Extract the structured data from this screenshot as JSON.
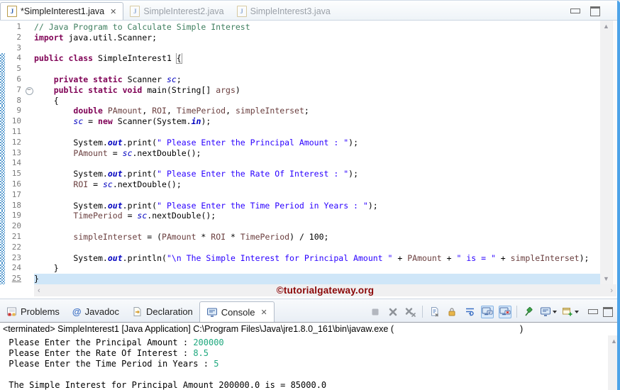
{
  "window": {
    "controls": {
      "minimize": "minimize",
      "maximize": "maximize"
    }
  },
  "editor_tabs": [
    {
      "label": "*SimpleInterest1.java",
      "active": true,
      "dirty": true
    },
    {
      "label": "SimpleInterest2.java",
      "active": false
    },
    {
      "label": "SimpleInterest3.java",
      "active": false
    }
  ],
  "editor": {
    "current_line": 25,
    "code_lines": [
      {
        "num": 1,
        "diff": false,
        "segments": [
          {
            "t": "// Java Program to Calculate Simple Interest",
            "s": "c"
          }
        ]
      },
      {
        "num": 2,
        "diff": false,
        "segments": [
          {
            "t": "import",
            "s": "k"
          },
          {
            "t": " java.util.Scanner;",
            "s": "p"
          }
        ]
      },
      {
        "num": 3,
        "diff": false,
        "segments": []
      },
      {
        "num": 4,
        "diff": true,
        "segments": [
          {
            "t": "public class",
            "s": "k"
          },
          {
            "t": " SimpleInterest1 ",
            "s": "p"
          },
          {
            "t": "{",
            "s": "b"
          }
        ]
      },
      {
        "num": 5,
        "diff": true,
        "segments": []
      },
      {
        "num": 6,
        "diff": true,
        "segments": [
          {
            "t": "    ",
            "s": "p"
          },
          {
            "t": "private static",
            "s": "k"
          },
          {
            "t": " Scanner ",
            "s": "p"
          },
          {
            "t": "sc",
            "s": "sf"
          },
          {
            "t": ";",
            "s": "p"
          }
        ]
      },
      {
        "num": 7,
        "diff": true,
        "fold": true,
        "segments": [
          {
            "t": "    ",
            "s": "p"
          },
          {
            "t": "public static void",
            "s": "k"
          },
          {
            "t": " main(String[] ",
            "s": "p"
          },
          {
            "t": "args",
            "s": "v"
          },
          {
            "t": ")",
            "s": "p"
          }
        ]
      },
      {
        "num": 8,
        "diff": true,
        "segments": [
          {
            "t": "    {",
            "s": "p"
          }
        ]
      },
      {
        "num": 9,
        "diff": true,
        "segments": [
          {
            "t": "        ",
            "s": "p"
          },
          {
            "t": "double",
            "s": "k"
          },
          {
            "t": " ",
            "s": "p"
          },
          {
            "t": "PAmount",
            "s": "v"
          },
          {
            "t": ", ",
            "s": "p"
          },
          {
            "t": "ROI",
            "s": "v"
          },
          {
            "t": ", ",
            "s": "p"
          },
          {
            "t": "TimePeriod",
            "s": "v"
          },
          {
            "t": ", ",
            "s": "p"
          },
          {
            "t": "simpleInterset",
            "s": "v"
          },
          {
            "t": ";",
            "s": "p"
          }
        ]
      },
      {
        "num": 10,
        "diff": true,
        "segments": [
          {
            "t": "        ",
            "s": "p"
          },
          {
            "t": "sc",
            "s": "sf"
          },
          {
            "t": " = ",
            "s": "p"
          },
          {
            "t": "new",
            "s": "k"
          },
          {
            "t": " Scanner(System.",
            "s": "p"
          },
          {
            "t": "in",
            "s": "cf"
          },
          {
            "t": ");",
            "s": "p"
          }
        ]
      },
      {
        "num": 11,
        "diff": true,
        "segments": []
      },
      {
        "num": 12,
        "diff": true,
        "segments": [
          {
            "t": "        System.",
            "s": "p"
          },
          {
            "t": "out",
            "s": "cf"
          },
          {
            "t": ".print(",
            "s": "p"
          },
          {
            "t": "\" Please Enter the Principal Amount : \"",
            "s": "s"
          },
          {
            "t": ");",
            "s": "p"
          }
        ]
      },
      {
        "num": 13,
        "diff": true,
        "segments": [
          {
            "t": "        ",
            "s": "p"
          },
          {
            "t": "PAmount",
            "s": "v"
          },
          {
            "t": " = ",
            "s": "p"
          },
          {
            "t": "sc",
            "s": "sf"
          },
          {
            "t": ".nextDouble();",
            "s": "p"
          }
        ]
      },
      {
        "num": 14,
        "diff": true,
        "segments": []
      },
      {
        "num": 15,
        "diff": true,
        "segments": [
          {
            "t": "        System.",
            "s": "p"
          },
          {
            "t": "out",
            "s": "cf"
          },
          {
            "t": ".print(",
            "s": "p"
          },
          {
            "t": "\" Please Enter the Rate Of Interest : \"",
            "s": "s"
          },
          {
            "t": ");",
            "s": "p"
          }
        ]
      },
      {
        "num": 16,
        "diff": true,
        "segments": [
          {
            "t": "        ",
            "s": "p"
          },
          {
            "t": "ROI",
            "s": "v"
          },
          {
            "t": " = ",
            "s": "p"
          },
          {
            "t": "sc",
            "s": "sf"
          },
          {
            "t": ".nextDouble();",
            "s": "p"
          }
        ]
      },
      {
        "num": 17,
        "diff": true,
        "segments": []
      },
      {
        "num": 18,
        "diff": true,
        "segments": [
          {
            "t": "        System.",
            "s": "p"
          },
          {
            "t": "out",
            "s": "cf"
          },
          {
            "t": ".print(",
            "s": "p"
          },
          {
            "t": "\" Please Enter the Time Period in Years : \"",
            "s": "s"
          },
          {
            "t": ");",
            "s": "p"
          }
        ]
      },
      {
        "num": 19,
        "diff": true,
        "segments": [
          {
            "t": "        ",
            "s": "p"
          },
          {
            "t": "TimePeriod",
            "s": "v"
          },
          {
            "t": " = ",
            "s": "p"
          },
          {
            "t": "sc",
            "s": "sf"
          },
          {
            "t": ".nextDouble();",
            "s": "p"
          }
        ]
      },
      {
        "num": 20,
        "diff": true,
        "segments": []
      },
      {
        "num": 21,
        "diff": true,
        "segments": [
          {
            "t": "        ",
            "s": "p"
          },
          {
            "t": "simpleInterset",
            "s": "v"
          },
          {
            "t": " = (",
            "s": "p"
          },
          {
            "t": "PAmount",
            "s": "v"
          },
          {
            "t": " * ",
            "s": "p"
          },
          {
            "t": "ROI",
            "s": "v"
          },
          {
            "t": " * ",
            "s": "p"
          },
          {
            "t": "TimePeriod",
            "s": "v"
          },
          {
            "t": ") / 100;",
            "s": "p"
          }
        ]
      },
      {
        "num": 22,
        "diff": true,
        "segments": []
      },
      {
        "num": 23,
        "diff": true,
        "segments": [
          {
            "t": "        System.",
            "s": "p"
          },
          {
            "t": "out",
            "s": "cf"
          },
          {
            "t": ".println(",
            "s": "p"
          },
          {
            "t": "\"\\n The Simple Interest for Principal Amount \"",
            "s": "s"
          },
          {
            "t": " + ",
            "s": "p"
          },
          {
            "t": "PAmount",
            "s": "v"
          },
          {
            "t": " + ",
            "s": "p"
          },
          {
            "t": "\" is = \"",
            "s": "s"
          },
          {
            "t": " + ",
            "s": "p"
          },
          {
            "t": "simpleInterset",
            "s": "v"
          },
          {
            "t": ");",
            "s": "p"
          }
        ]
      },
      {
        "num": 24,
        "diff": true,
        "segments": [
          {
            "t": "    }",
            "s": "p"
          }
        ]
      },
      {
        "num": 25,
        "diff": true,
        "current": true,
        "segments": [
          {
            "t": "}",
            "s": "p"
          }
        ]
      }
    ]
  },
  "watermark": "©tutorialgateway.org",
  "console": {
    "tabs": [
      {
        "label": "Problems",
        "icon": "problems-icon",
        "active": false
      },
      {
        "label": "Javadoc",
        "icon": "javadoc-icon",
        "active": false
      },
      {
        "label": "Declaration",
        "icon": "declaration-icon",
        "active": false
      },
      {
        "label": "Console",
        "icon": "console-icon",
        "active": true
      }
    ],
    "status": {
      "prefix": "<terminated> SimpleInterest1 [Java Application] C:\\Program Files\\Java\\jre1.8.0_161\\bin\\javaw.exe (",
      "suffix": ")"
    },
    "output": [
      {
        "segments": [
          {
            "t": " Please Enter the Principal Amount : ",
            "s": "stdout"
          },
          {
            "t": "200000",
            "s": "stdin"
          }
        ]
      },
      {
        "segments": [
          {
            "t": " Please Enter the Rate Of Interest : ",
            "s": "stdout"
          },
          {
            "t": "8.5",
            "s": "stdin"
          }
        ]
      },
      {
        "segments": [
          {
            "t": " Please Enter the Time Period in Years : ",
            "s": "stdout"
          },
          {
            "t": "5",
            "s": "stdin"
          }
        ]
      },
      {
        "segments": []
      },
      {
        "segments": [
          {
            "t": " The Simple Interest for Principal Amount 200000.0 is = 85000.0",
            "s": "stdout"
          }
        ]
      }
    ]
  },
  "colors": {
    "accent_border": "#4DA3E8",
    "keyword": "#7F0055",
    "comment": "#3F7F5F",
    "string": "#2A00FF",
    "static_field": "#0000C0",
    "local_var": "#6A3E3E",
    "stdin_green": "#1FA87E",
    "current_line_bg": "#CFE6F8",
    "watermark_red": "#8B0606"
  }
}
